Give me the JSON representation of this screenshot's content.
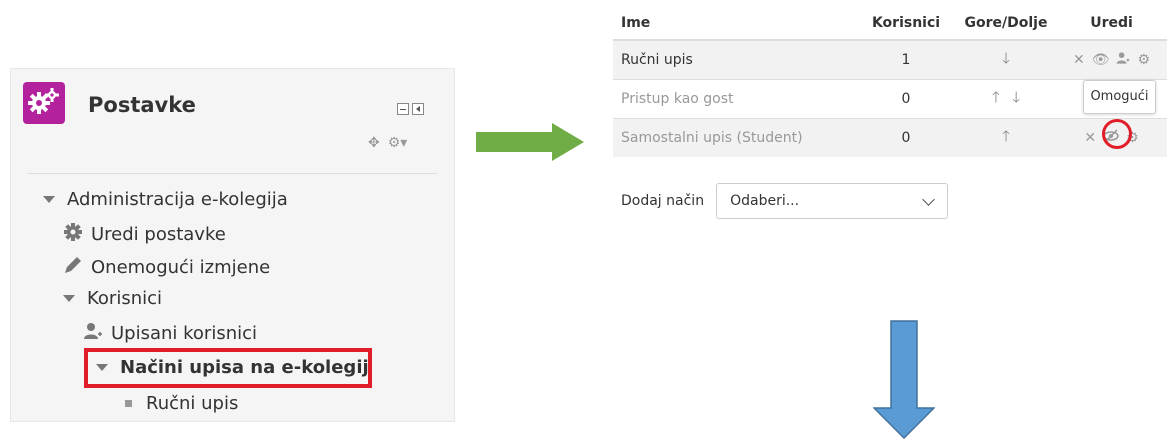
{
  "settings_block": {
    "title": "Postavke",
    "tree": {
      "admin": "Administracija e-kolegija",
      "edit_settings": "Uredi postavke",
      "disable_changes": "Onemogući izmjene",
      "users": "Korisnici",
      "enrolled_users": "Upisani korisnici",
      "enrol_methods": "Načini upisa na e-kolegij",
      "manual_enrol": "Ručni upis"
    }
  },
  "enrol_table": {
    "headers": {
      "name": "Ime",
      "users": "Korisnici",
      "updown": "Gore/Dolje",
      "edit": "Uredi"
    },
    "rows": [
      {
        "name": "Ručni upis",
        "users": "1"
      },
      {
        "name": "Pristup kao gost",
        "users": "0"
      },
      {
        "name": "Samostalni upis (Student)",
        "users": "0"
      }
    ],
    "tooltip": "Omogući"
  },
  "add_method": {
    "label": "Dodaj način",
    "select_value": "Odaberi..."
  },
  "colors": {
    "block_icon": "#b3229c",
    "highlight": "#e11d2a",
    "green_arrow": "#70ad47",
    "blue_arrow": "#5b9bd5"
  }
}
